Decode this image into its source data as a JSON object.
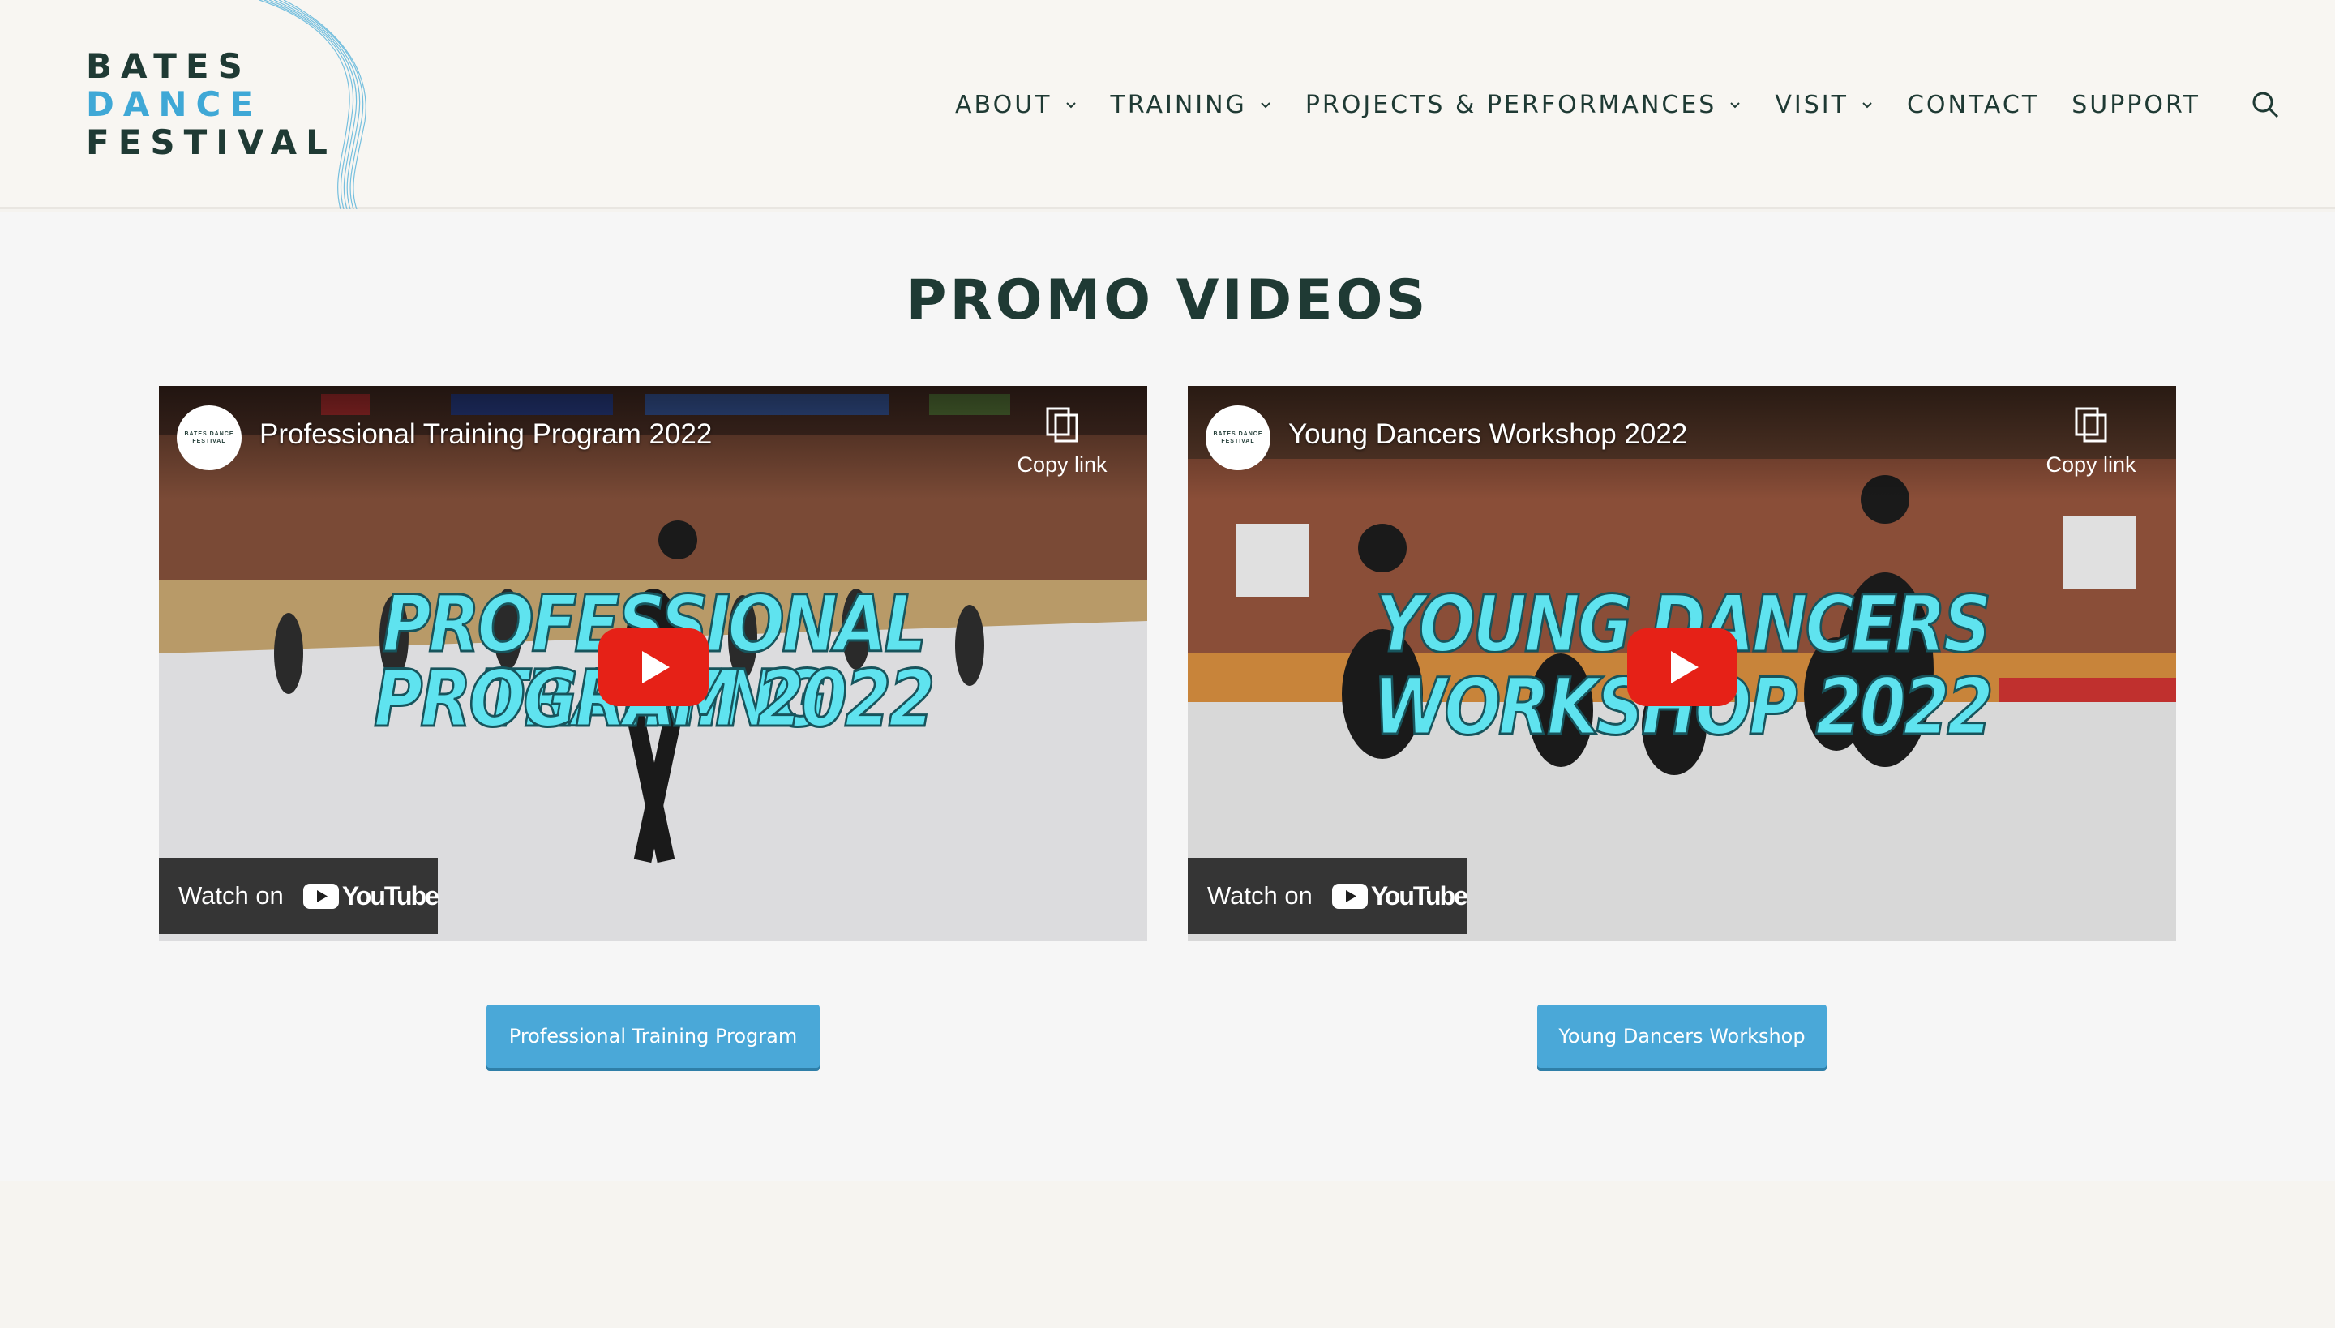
{
  "logo": {
    "line1": "BATES",
    "line2": "DANCE",
    "line3": "FESTIVAL"
  },
  "nav": [
    {
      "label": "ABOUT",
      "dropdown": true
    },
    {
      "label": "TRAINING",
      "dropdown": true
    },
    {
      "label": "PROJECTS & PERFORMANCES",
      "dropdown": true
    },
    {
      "label": "VISIT",
      "dropdown": true
    },
    {
      "label": "CONTACT",
      "dropdown": false
    },
    {
      "label": "SUPPORT",
      "dropdown": false
    }
  ],
  "page": {
    "title": "PROMO VIDEOS"
  },
  "videos": [
    {
      "title": "Professional Training Program 2022",
      "channel_avatar": "BATES DANCE FESTIVAL",
      "copy_link": "Copy link",
      "overlay_line1": "PROFESSIONAL TRAINING",
      "overlay_line2": "PROGRAM 2022",
      "watch_on": "Watch on",
      "youtube": "YouTube",
      "button": "Professional Training Program"
    },
    {
      "title": "Young Dancers Workshop 2022",
      "channel_avatar": "BATES DANCE FESTIVAL",
      "copy_link": "Copy link",
      "overlay_line1": "YOUNG DANCERS",
      "overlay_line2": "WORKSHOP 2022",
      "watch_on": "Watch on",
      "youtube": "YouTube",
      "button": "Young Dancers Workshop"
    }
  ],
  "colors": {
    "brand_dark": "#1f3a34",
    "brand_blue": "#3fa8d6",
    "button": "#4aa8d8",
    "overlay_text": "#5fe3ef",
    "youtube_red": "#e62117"
  },
  "icons": {
    "search": "search-icon",
    "chevron": "chevron-down-icon",
    "copy": "copy-link-icon",
    "play": "youtube-play-icon"
  }
}
